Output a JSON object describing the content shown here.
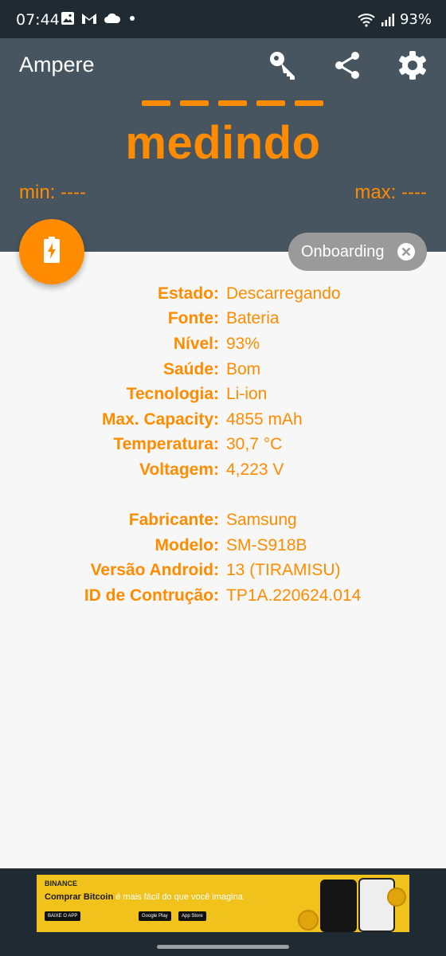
{
  "status_bar": {
    "time": "07:44",
    "battery_percent": "93%",
    "icons": [
      "gallery-icon",
      "gmail-icon",
      "cloud-icon",
      "dot-icon",
      "wifi-icon",
      "signal-icon"
    ]
  },
  "app_bar": {
    "title": "Ampere",
    "actions": [
      "key-icon",
      "share-icon",
      "settings-icon"
    ]
  },
  "meter": {
    "reading": "medindo",
    "min": "min: ----",
    "max": "max: ----"
  },
  "fab": {
    "icon": "battery-charging-icon"
  },
  "onboarding": {
    "label": "Onboarding",
    "close_icon": "close-icon"
  },
  "battery_info": [
    {
      "label": "Estado:",
      "value": "Descarregando"
    },
    {
      "label": "Fonte:",
      "value": "Bateria"
    },
    {
      "label": "Nível:",
      "value": "93%"
    },
    {
      "label": "Saúde:",
      "value": "Bom"
    },
    {
      "label": "Tecnologia:",
      "value": "Li-ion"
    },
    {
      "label": "Max. Capacity:",
      "value": "4855 mAh"
    },
    {
      "label": "Temperatura:",
      "value": "30,7 °C"
    },
    {
      "label": "Voltagem:",
      "value": "4,223 V"
    }
  ],
  "device_info": [
    {
      "label": "Fabricante:",
      "value": "Samsung"
    },
    {
      "label": "Modelo:",
      "value": "SM-S918B"
    },
    {
      "label": "Versão Android:",
      "value": "13 (TIRAMISU)"
    },
    {
      "label": "ID de Contrução:",
      "value": "TP1A.220624.014"
    }
  ],
  "ad": {
    "brand": "BINANCE",
    "headline_bold": "Comprar Bitcoin",
    "headline_rest": " é mais fácil do que você imagina",
    "cta": "BAIXE O APP",
    "store1": "Google Play",
    "store2": "App Store"
  },
  "colors": {
    "accent": "#ff8c00",
    "header": "#46555f",
    "status_bar": "#1f2a32",
    "background": "#f7f7f7",
    "chip": "#9a9a9a"
  }
}
